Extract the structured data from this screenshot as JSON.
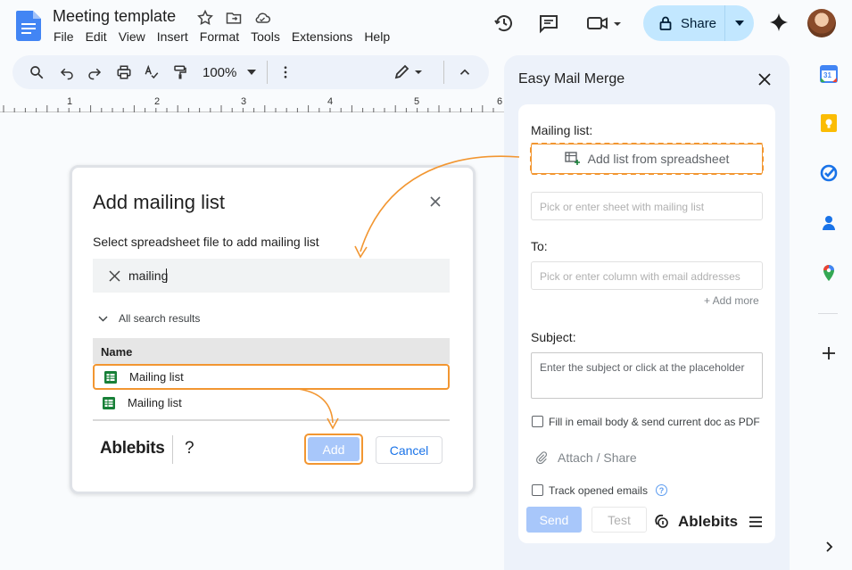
{
  "header": {
    "doc_title": "Meeting template",
    "menu": [
      "File",
      "Edit",
      "View",
      "Insert",
      "Format",
      "Tools",
      "Extensions",
      "Help"
    ],
    "share_label": "Share"
  },
  "toolbar": {
    "zoom": "100%",
    "ruler_marks": [
      "1",
      "2",
      "3",
      "4",
      "5",
      "6"
    ]
  },
  "dialog": {
    "title": "Add mailing list",
    "subtitle": "Select spreadsheet file to add mailing list",
    "search_value": "mailing",
    "results_label": "All search results",
    "column_header": "Name",
    "rows": [
      "Mailing list",
      "Mailing list"
    ],
    "brand": "Ablebits",
    "help": "?",
    "add_label": "Add",
    "cancel_label": "Cancel"
  },
  "panel": {
    "title": "Easy Mail Merge",
    "mailing_list_label": "Mailing list:",
    "add_list_button": "Add list from spreadsheet",
    "sheet_placeholder": "Pick or enter sheet with mailing list",
    "to_label": "To:",
    "to_placeholder": "Pick or enter column with email addresses",
    "add_more": "+ Add more",
    "subject_label": "Subject:",
    "subject_placeholder": "Enter the subject or click at the placeholder",
    "fill_pdf_label": "Fill in email body & send current doc as PDF",
    "attach_label": "Attach / Share",
    "track_label": "Track opened emails",
    "send_label": "Send",
    "test_label": "Test",
    "brand": "Ablebits"
  },
  "colors": {
    "accent_orange": "#f29631",
    "share_bg": "#c2e7ff",
    "button_disabled_blue": "#a8c7fa",
    "panel_bg": "#edf2fa"
  },
  "rail": {
    "calendar_day": "31"
  }
}
